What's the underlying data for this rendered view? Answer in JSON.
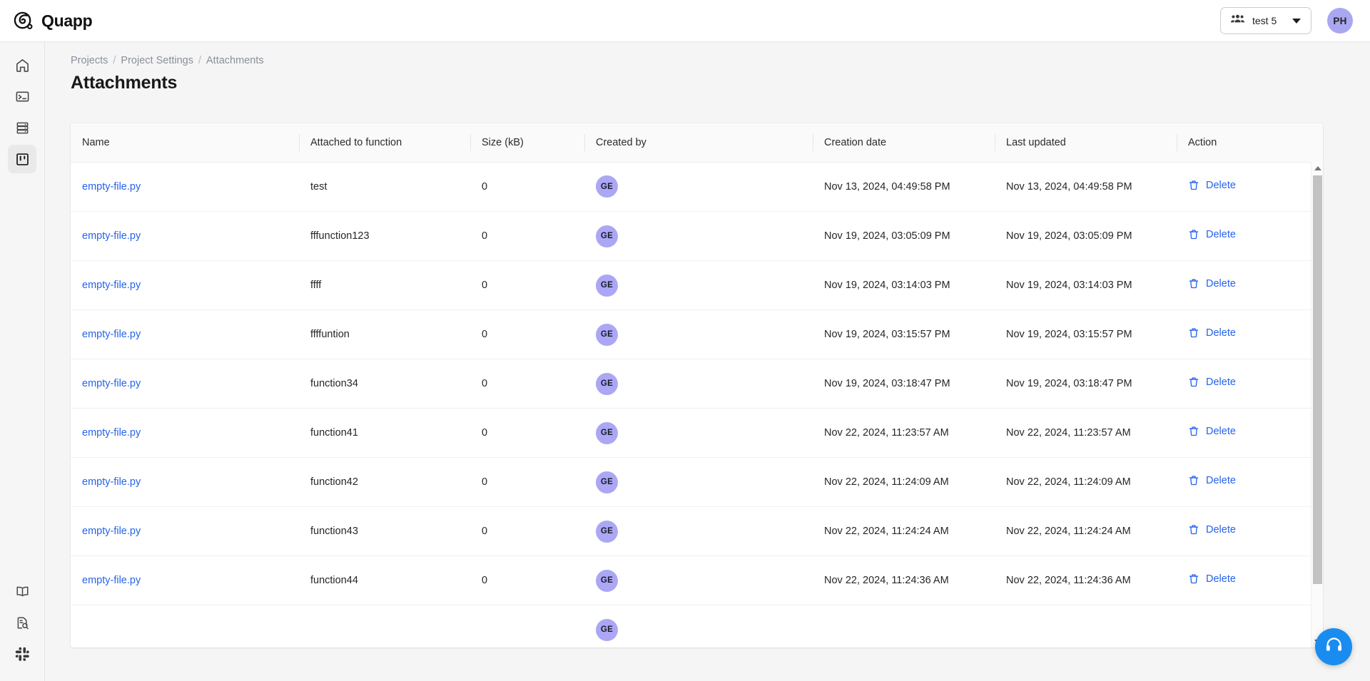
{
  "app": {
    "brand_name": "Quapp",
    "logo_icon": "quapp-spiral-logo"
  },
  "topbar": {
    "team_switcher": {
      "icon": "users-group-icon",
      "label": "test 5",
      "caret_icon": "chevron-down-icon"
    },
    "user_avatar": {
      "initials": "PH",
      "color": "#a9a6f2"
    }
  },
  "sidebar": {
    "items": [
      {
        "icon": "home-icon",
        "name": "home",
        "active": false
      },
      {
        "icon": "terminal-icon",
        "name": "console",
        "active": false
      },
      {
        "icon": "server-stack-icon",
        "name": "database",
        "active": false
      },
      {
        "icon": "kanban-board-icon",
        "name": "projects",
        "active": true
      }
    ],
    "bottom_items": [
      {
        "icon": "book-open-icon",
        "name": "documentation"
      },
      {
        "icon": "document-search-icon",
        "name": "logs-search"
      },
      {
        "icon": "slack-icon",
        "name": "slack-community"
      }
    ]
  },
  "breadcrumb": {
    "items": [
      "Projects",
      "Project Settings",
      "Attachments"
    ],
    "separator": "/"
  },
  "page": {
    "title": "Attachments"
  },
  "table": {
    "columns": [
      "Name",
      "Attached to function",
      "Size (kB)",
      "Created by",
      "Creation date",
      "Last updated",
      "Action"
    ],
    "action_label": "Delete",
    "action_icon": "trash-icon",
    "rows": [
      {
        "name": "empty-file.py",
        "function": "test",
        "size": "0",
        "created_by": "GE",
        "creation_date": "Nov 13, 2024, 04:49:58 PM",
        "last_updated": "Nov 13, 2024, 04:49:58 PM",
        "action": "Delete"
      },
      {
        "name": "empty-file.py",
        "function": "fffunction123",
        "size": "0",
        "created_by": "GE",
        "creation_date": "Nov 19, 2024, 03:05:09 PM",
        "last_updated": "Nov 19, 2024, 03:05:09 PM",
        "action": "Delete"
      },
      {
        "name": "empty-file.py",
        "function": "ffff",
        "size": "0",
        "created_by": "GE",
        "creation_date": "Nov 19, 2024, 03:14:03 PM",
        "last_updated": "Nov 19, 2024, 03:14:03 PM",
        "action": "Delete"
      },
      {
        "name": "empty-file.py",
        "function": "ffffuntion",
        "size": "0",
        "created_by": "GE",
        "creation_date": "Nov 19, 2024, 03:15:57 PM",
        "last_updated": "Nov 19, 2024, 03:15:57 PM",
        "action": "Delete"
      },
      {
        "name": "empty-file.py",
        "function": "function34",
        "size": "0",
        "created_by": "GE",
        "creation_date": "Nov 19, 2024, 03:18:47 PM",
        "last_updated": "Nov 19, 2024, 03:18:47 PM",
        "action": "Delete"
      },
      {
        "name": "empty-file.py",
        "function": "function41",
        "size": "0",
        "created_by": "GE",
        "creation_date": "Nov 22, 2024, 11:23:57 AM",
        "last_updated": "Nov 22, 2024, 11:23:57 AM",
        "action": "Delete"
      },
      {
        "name": "empty-file.py",
        "function": "function42",
        "size": "0",
        "created_by": "GE",
        "creation_date": "Nov 22, 2024, 11:24:09 AM",
        "last_updated": "Nov 22, 2024, 11:24:09 AM",
        "action": "Delete"
      },
      {
        "name": "empty-file.py",
        "function": "function43",
        "size": "0",
        "created_by": "GE",
        "creation_date": "Nov 22, 2024, 11:24:24 AM",
        "last_updated": "Nov 22, 2024, 11:24:24 AM",
        "action": "Delete"
      },
      {
        "name": "empty-file.py",
        "function": "function44",
        "size": "0",
        "created_by": "GE",
        "creation_date": "Nov 22, 2024, 11:24:36 AM",
        "last_updated": "Nov 22, 2024, 11:24:36 AM",
        "action": "Delete"
      },
      {
        "name": "",
        "function": "",
        "size": "",
        "created_by": "GE",
        "creation_date": "",
        "last_updated": "",
        "action": ""
      }
    ]
  },
  "scrollbar": {
    "up_arrow_icon": "triangle-up-icon",
    "down_arrow_icon": "triangle-down-icon"
  },
  "support": {
    "icon": "headset-icon",
    "color": "#1a8cf0"
  },
  "colors": {
    "link": "#2563eb",
    "avatar": "#aba7f4",
    "accent": "#1a8cf0"
  }
}
